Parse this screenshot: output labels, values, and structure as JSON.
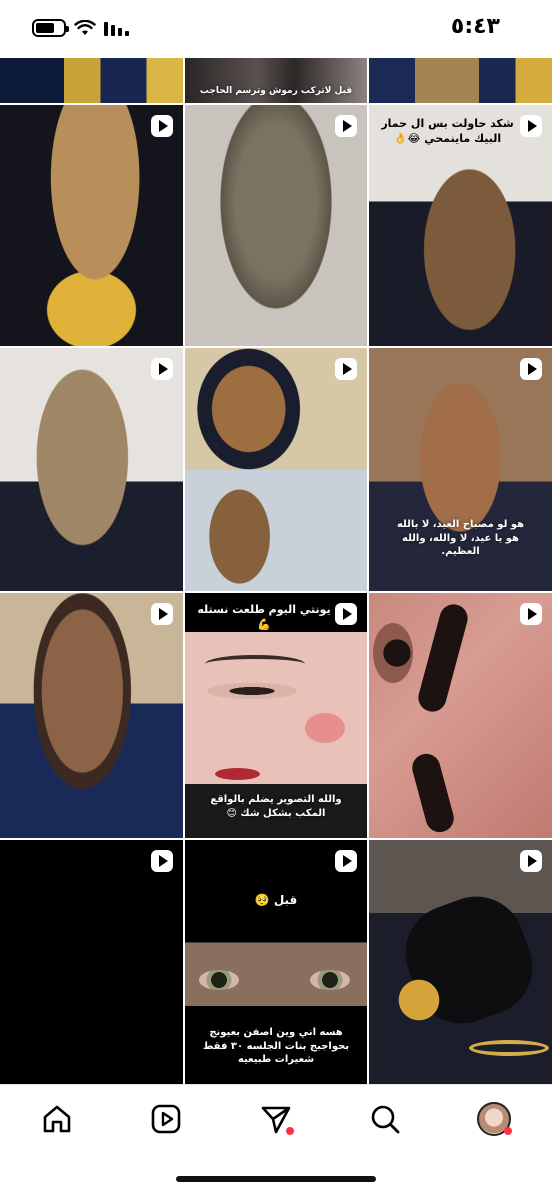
{
  "status_bar": {
    "time": "٥:٤٣"
  },
  "grid": {
    "captions": {
      "top_middle": "قبل لاتركب رموش وترسم الحاجب",
      "r1c3": "شكد حاولت بس ال حمار البيك ماينمحي 😂👌",
      "r2c3": "هو لو مصباح العيد، لا بالله هو يا عيد، لا والله، والله العظيم.",
      "r3c2_top": "يونتي اليوم طلعت نستله 💪",
      "r3c2_bottom": "والله التصوير يضلم بالواقع المكب بشكل شك 😊",
      "r4c2_top": "قبل 🥺",
      "r4c2_bottom": "هسه اني وين اصفن بعيونج بحواجبج بنات الجلسه ٣٠ فقط شعيرات طبيعيه"
    }
  },
  "nav": {
    "items": [
      "home-icon",
      "reels-icon",
      "direct-icon",
      "search-icon",
      "profile-avatar"
    ],
    "notification_color": "#ff3040"
  }
}
